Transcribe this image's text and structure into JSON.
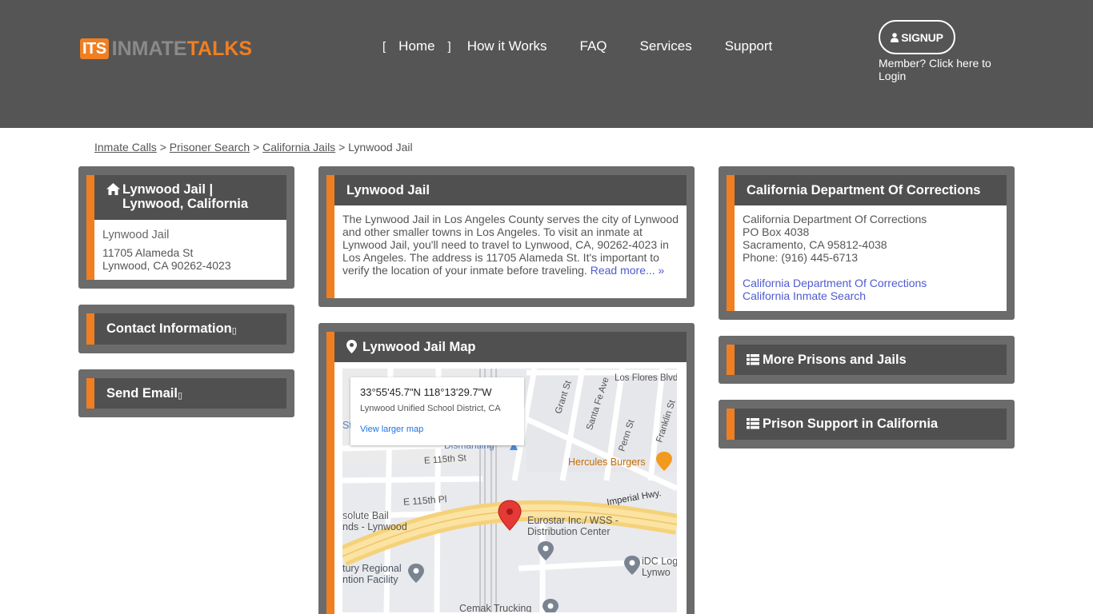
{
  "header": {
    "logo_badge": "ITS",
    "logo_inmate": "INMATE",
    "logo_talks": "TALKS",
    "nav": {
      "bracket_left": "[",
      "home": "Home",
      "bracket_right": "]",
      "how_it_works": "How it Works",
      "faq": "FAQ",
      "services": "Services",
      "support": "Support"
    },
    "signup_label": "SIGNUP",
    "login_text": "Member? Click here to Login"
  },
  "breadcrumb": {
    "items": [
      "Inmate Calls",
      "Prisoner Search",
      "California Jails"
    ],
    "separator": ">",
    "current": "Lynwood Jail"
  },
  "left": {
    "facility_card": {
      "title": "Lynwood Jail | Lynwood, California",
      "name": "Lynwood Jail",
      "street": "11705 Alameda St",
      "city_line": "Lynwood, CA 90262-4023"
    },
    "contact_title": "Contact Information ",
    "contact_glyph": "▯",
    "email_title": "Send Email ",
    "email_glyph": "▯"
  },
  "middle": {
    "about_card": {
      "title": "Lynwood Jail",
      "text": "The Lynwood Jail in Los Angeles County serves the city of Lynwood and other smaller towns in Los Angeles. To visit an inmate at Lynwood Jail, you'll need to travel to Lynwood, CA, 90262-4023 in Los Angeles. The address is 11705 Alameda St. It's important to verify the location of your inmate before traveling. ",
      "read_more": "Read more... »"
    },
    "map_card": {
      "title": "Lynwood Jail Map",
      "popup_coord": "33°55'45.7\"N 118°13'29.7\"W",
      "popup_district": "Lynwood Unified School District, CA",
      "popup_link": "View larger map",
      "labels": {
        "los_flores": "Los Flores Blvd",
        "grant": "Grant St",
        "santa_fe": "Santa Fe Ave",
        "penn": "Penn St",
        "franklin": "Franklin St",
        "e115st": "E 115th St",
        "e115pl": "E 115th Pl",
        "imperial": "Imperial Hwy.",
        "hercules": "Hercules Burgers",
        "dismantling": "Dismantling",
        "bail1": "solute Bail",
        "bail2": "nds - Lynwood",
        "eurostar1": "Eurostar Inc./ WSS -",
        "eurostar2": "Distribution Center",
        "regional1": "tury Regional",
        "regional2": "ntion Facility",
        "idc1": "iDC Log",
        "idc2": "Lynwo",
        "cemak": "Cemak Trucking",
        "st": "St"
      }
    }
  },
  "right": {
    "doc_card": {
      "title": "California Department Of Corrections",
      "name": "California Department Of Corrections",
      "box": "PO Box 4038",
      "city": "Sacramento, CA 95812-4038",
      "phone": "Phone: (916) 445-6713",
      "link1": "California Department Of Corrections",
      "link2": "California Inmate Search"
    },
    "more_title": "More Prisons and Jails",
    "support_title": "Prison Support in California"
  },
  "colors": {
    "header_bg": "#555555",
    "accent": "#f07f22",
    "card_outer": "#6b6b6b",
    "card_head": "#505050",
    "link": "#4e5bd0"
  }
}
